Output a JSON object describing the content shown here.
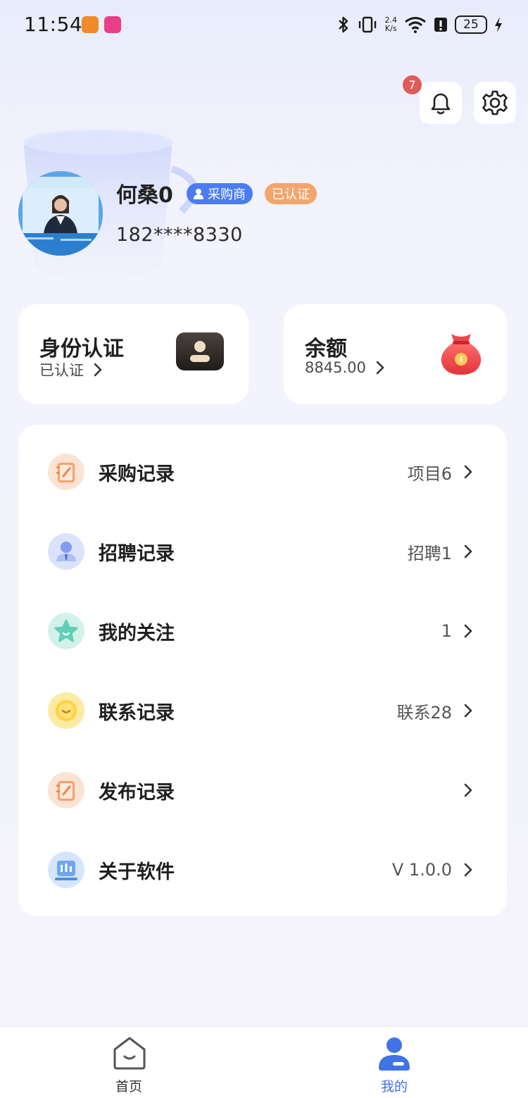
{
  "status_bar": {
    "time": "11:54",
    "net_speed_value": "2.4",
    "net_speed_unit": "K/s",
    "battery": "25"
  },
  "header": {
    "notification_count": "7"
  },
  "profile": {
    "name": "何桑0",
    "role_tag": "采购商",
    "verified_tag": "已认证",
    "phone": "182****8330"
  },
  "cards": {
    "identity": {
      "title": "身份认证",
      "subtitle": "已认证"
    },
    "balance": {
      "title": "余额",
      "subtitle": "8845.00"
    }
  },
  "menu": [
    {
      "label": "采购记录",
      "value": "项目6",
      "icon": "notebook-orange-icon"
    },
    {
      "label": "招聘记录",
      "value": "招聘1",
      "icon": "person-blue-icon"
    },
    {
      "label": "我的关注",
      "value": "1",
      "icon": "star-teal-icon"
    },
    {
      "label": "联系记录",
      "value": "联系28",
      "icon": "chat-yellow-icon"
    },
    {
      "label": "发布记录",
      "value": "",
      "icon": "notebook-orange-icon"
    },
    {
      "label": "关于软件",
      "value": "V 1.0.0",
      "icon": "monitor-blue-icon"
    }
  ],
  "tabbar": {
    "home_label": "首页",
    "me_label": "我的"
  },
  "colors": {
    "accent": "#4a7cf0",
    "tab_active": "#3f73e6",
    "badge": "#e05a5a",
    "verified": "#f4a56b"
  }
}
